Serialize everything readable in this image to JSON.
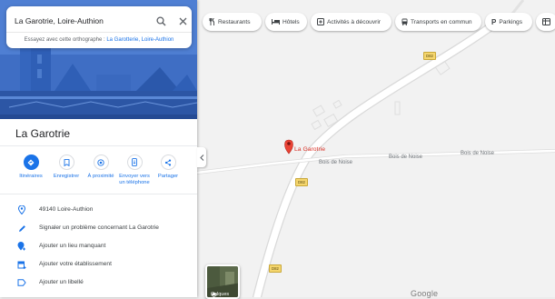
{
  "search": {
    "value": "La Garotrie, Loire-Authion",
    "suggest_prefix": "Essayez avec cette orthographe : ",
    "suggest_link": "La Garotterie, Loire-Authion"
  },
  "place": {
    "title": "La Garotrie"
  },
  "actions": [
    {
      "label": "Itinéraires"
    },
    {
      "label": "Enregistrer"
    },
    {
      "label": "À proximité"
    },
    {
      "label_line1": "Envoyer vers",
      "label_line2": "un téléphone"
    },
    {
      "label": "Partager"
    }
  ],
  "info_rows": [
    {
      "text": "49140 Loire-Authion"
    },
    {
      "text": "Signaler un problème concernant La Garotrie"
    },
    {
      "text": "Ajouter un lieu manquant"
    },
    {
      "text": "Ajouter votre établissement"
    },
    {
      "text": "Ajouter un libellé"
    }
  ],
  "chips": [
    {
      "label": "Restaurants"
    },
    {
      "label": "Hôtels"
    },
    {
      "label": "Activités à découvrir"
    },
    {
      "label": "Transports en commun"
    },
    {
      "label": "Parkings"
    }
  ],
  "map": {
    "pin_label": "La Garotrie",
    "road_label_1": "Bois de Noise",
    "road_label_2": "Bois de Noise",
    "road_label_3": "Bois de Noise",
    "shield_1": "D82",
    "shield_2": "D82",
    "shield_3": "D82",
    "layers_label": "Calques",
    "logo": "Google"
  },
  "colors": {
    "accent": "#1a73e8",
    "pin": "#ea4335",
    "hero": "#4f7fd3"
  }
}
